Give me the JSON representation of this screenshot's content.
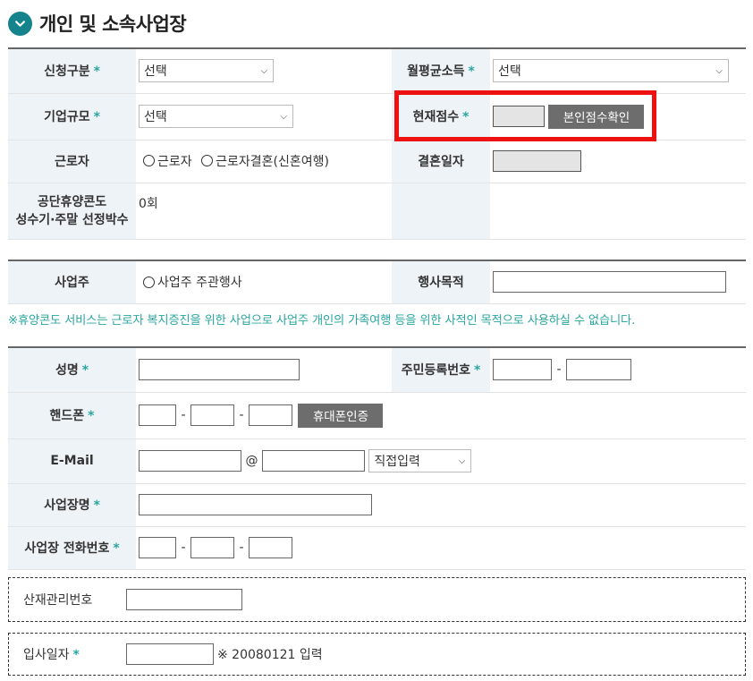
{
  "section": {
    "title": "개인 및 소속사업장"
  },
  "required_mark": "*",
  "table1": {
    "apply_type": {
      "label": "신청구분",
      "value": "선택"
    },
    "monthly_income": {
      "label": "월평균소득",
      "value": "선택"
    },
    "company_size": {
      "label": "기업규모",
      "value": "선택"
    },
    "current_score": {
      "label": "현재점수",
      "button": "본인점수확인"
    },
    "worker": {
      "label": "근로자",
      "options": [
        "근로자",
        "근로자결혼(신혼여행)"
      ]
    },
    "marriage_date": {
      "label": "결혼일자"
    },
    "selection_count": {
      "label_line1": "공단휴양콘도",
      "label_line2": "성수기·주말 선정박수",
      "value": "0회"
    }
  },
  "table2": {
    "employer": {
      "label": "사업주",
      "option": "사업주 주관행사"
    },
    "event_purpose": {
      "label": "행사목적"
    }
  },
  "notice": "※휴양콘도 서비스는 근로자 복지증진을 위한 사업으로 사업주 개인의 가족여행 등을 위한 사적인 목적으로 사용하실 수 없습니다.",
  "table3": {
    "name": {
      "label": "성명"
    },
    "resident_no": {
      "label": "주민등록번호"
    },
    "phone": {
      "label": "핸드폰",
      "button": "휴대폰인증"
    },
    "email": {
      "label": "E-Mail",
      "at": "@",
      "domain_select": "직접입력"
    },
    "company_name": {
      "label": "사업장명"
    },
    "company_phone": {
      "label": "사업장 전화번호"
    }
  },
  "accident_no": {
    "label": "산재관리번호"
  },
  "join_date": {
    "label": "입사일자",
    "hint": "※ 20080121 입력"
  },
  "colors": {
    "accent": "#14838c",
    "required": "#2aa6a0",
    "highlight": "#ee1111",
    "label_bg": "#eef3f7"
  }
}
